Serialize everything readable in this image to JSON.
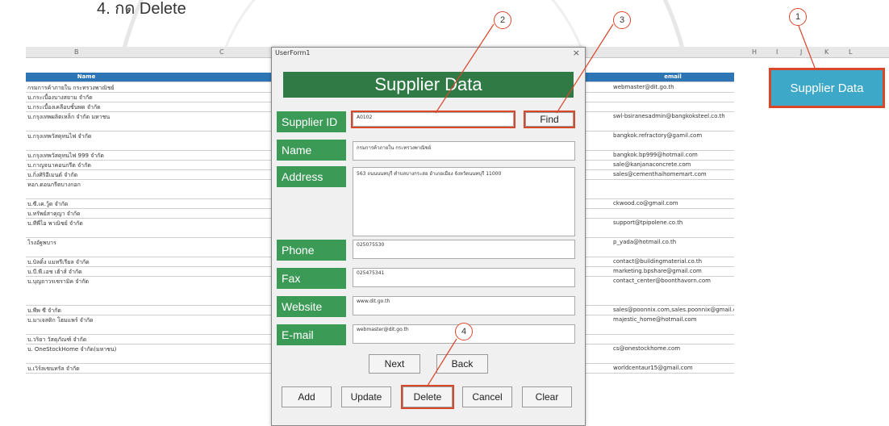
{
  "heading": "4. กด Delete",
  "side_button": "Supplier Data",
  "form": {
    "window_title": "UserForm1",
    "close": "×",
    "banner": "Supplier Data",
    "labels": {
      "supplier_id": "Supplier ID",
      "name": "Name",
      "address": "Address",
      "phone": "Phone",
      "fax": "Fax",
      "website": "Website",
      "email": "E-mail"
    },
    "values": {
      "supplier_id": "A0102",
      "name": "กรมการค้าภายใน กระทรวงพาณิชย์",
      "address": "563 ถนนนนทบุรี ตำบลบางกระสอ อำเภอเมือง จังหวัดนนทบุรี 11000",
      "phone": "025075530",
      "fax": "025475341",
      "website": "www.dit.go.th",
      "email": "webmaster@dit.go.th"
    },
    "buttons": {
      "find": "Find",
      "next": "Next",
      "back": "Back",
      "add": "Add",
      "update": "Update",
      "delete": "Delete",
      "cancel": "Cancel",
      "clear": "Clear"
    }
  },
  "callouts": [
    "1",
    "2",
    "3",
    "4"
  ],
  "sheet": {
    "columns": [
      "B",
      "C",
      "H",
      "I",
      "J",
      "K",
      "L"
    ],
    "header_name": "Name",
    "header_email": "email",
    "names": [
      "กรมการค้าภายใน กระทรวงพาณิชย์",
      "บ.กระเบื้องบางสยาม จำกัด",
      "บ.กระเบื้องเคลือบชั้นพด จำกัด",
      "บ.กรุงเทพผลิตเหล็ก จำกัด มหาชน",
      "บ.กรุงเทพวัสดุทนไฟ จำกัด",
      "บ.กรุงเทพวัสดุทนไฟ 999 จำกัด",
      "บ.กาญจนาคอนกรีต จำกัด",
      "บ.กิ่งศิริอีเมนต์ จำกัด",
      "หอก.ดอนกรีตบางกอก",
      "บ.ซี.เค.วู้ด จำกัด",
      "บ.ทรัพย์สาคุญา จำกัด",
      "บ.ทีพีไอ พาณิชย์ จำกัด",
      "โรงอัฐพบาร",
      "บ.บิลดิ้ง แมทรีเรียล จำกัด",
      "บ.บี.พี.เอช เฮ้าส์ จำกัด",
      "บ.บุญถาวรเซรามิค จำกัด",
      "บ.พีพ ซี จำกัด",
      "บ.มาเจสติก โฮมแพร์ จำกัด",
      "บ.วริยา วัสดุภัณฑ์ จำกัด",
      "บ. OneStockHome จำกัด(มหาชน)",
      "บ.เวิร์ลเซนทรัล จำกัด"
    ],
    "emails": [
      "webmaster@dit.go.th",
      "",
      "",
      "swl-bsiranesadmin@bangkoksteel.co.th",
      "bangkok.refractory@gamil.com",
      "bangkok.bp999@hotmail.com",
      "sale@kanjanaconcrete.com",
      "sales@cementhaihomemart.com",
      "",
      "ckwood.co@gmail.com",
      "",
      "support@tpipolene.co.th",
      "p_yada@hotmail.co.th",
      "contact@buildingmaterial.co.th",
      "marketing.bpshare@gmail.com",
      "contact_center@boonthavorn.com",
      "sales@poonnix.com,sales.poonnix@gmail.com",
      "majestic_home@hotmail.com",
      "",
      "cs@onestockhome.com",
      "worldcentaur15@gmail.com"
    ]
  }
}
